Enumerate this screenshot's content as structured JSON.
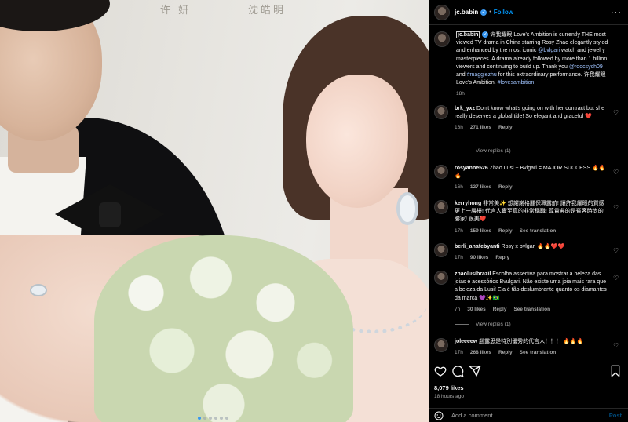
{
  "media": {
    "caption_left": "许 妍",
    "caption_right": "沈皓明",
    "slide_count": 6,
    "active_slide": 1
  },
  "header": {
    "username": "jc.babin",
    "follow_label": "Follow",
    "separator": "•",
    "more_label": "···"
  },
  "caption": {
    "username": "jc.babin",
    "text_1": " 许我耀眼 Love's Ambition is currently THE most viewed TV drama in China starring Rosy Zhao elegantly styled and enhanced by the most iconic ",
    "mention_1": "@bvlgari",
    "text_2": " watch and jewelry masterpieces. A drama already followed by more than 1 billion viewers and continuing to build up. Thank you ",
    "mention_2": "@roocsych09",
    "text_3": " and ",
    "mention_3": "#maggiezhu",
    "text_4": " for this extraordinary performance. 许我耀眼 Love's Ambition. ",
    "hashtag": "#lovesambition",
    "time": "18h"
  },
  "comments": [
    {
      "username": "brk_yxz",
      "text": " Don't know what's going on with her contract but she really deserves a global title! So elegant and graceful ❤️",
      "time": "16h",
      "likes": "271 likes",
      "reply": "Reply",
      "view_replies": "View replies (1)"
    },
    {
      "username": "rosyanne526",
      "text": " Zhao Lusi + Bvlgari = MAJOR SUCCESS 🔥🔥🔥",
      "time": "16h",
      "likes": "127 likes",
      "reply": "Reply"
    },
    {
      "username": "kerryhong",
      "text": " 非常美✨ 想謝謝格麗保珮露航! 讓許我耀眼的質感更上一層樓! 代言人實至真的非常稱職! 尊貴典的是賓客時尚的勝家! 很美❤️",
      "time": "17h",
      "likes": "159 likes",
      "reply": "Reply",
      "translate": "See translation"
    },
    {
      "username": "berli_anafebyanti",
      "text": " Rosy x bvlgari 🔥🔥❤️❤️",
      "time": "17h",
      "likes": "90 likes",
      "reply": "Reply"
    },
    {
      "username": "zhaolusibrazil",
      "text": " Escolha assertiva para mostrar a beleza das joias é acessórios Bvulgari. Não existe uma joia mais rara que a beleza da Lusi! Ela é tão deslumbrante quanto os diamantes da marca 💜✨🇧🇷",
      "time": "7h",
      "likes": "30 likes",
      "reply": "Reply",
      "translate": "See translation",
      "view_replies": "View replies (1)"
    },
    {
      "username": "joleeeew",
      "text": " 趙露思是特別優秀的代言人！！！ 🔥🔥🔥",
      "time": "17h",
      "likes": "268 likes",
      "reply": "Reply",
      "translate": "See translation"
    }
  ],
  "footer": {
    "likes": "8,079 likes",
    "time_ago": "18 hours ago",
    "add_comment_placeholder": "Add a comment...",
    "post_label": "Post"
  },
  "colors": {
    "accent": "#0095f6",
    "background": "#000000",
    "muted": "#a8a8a8"
  },
  "icons": [
    "heart-icon",
    "comment-icon",
    "share-icon",
    "bookmark-icon",
    "emoji-icon",
    "more-icon",
    "verified-icon"
  ]
}
